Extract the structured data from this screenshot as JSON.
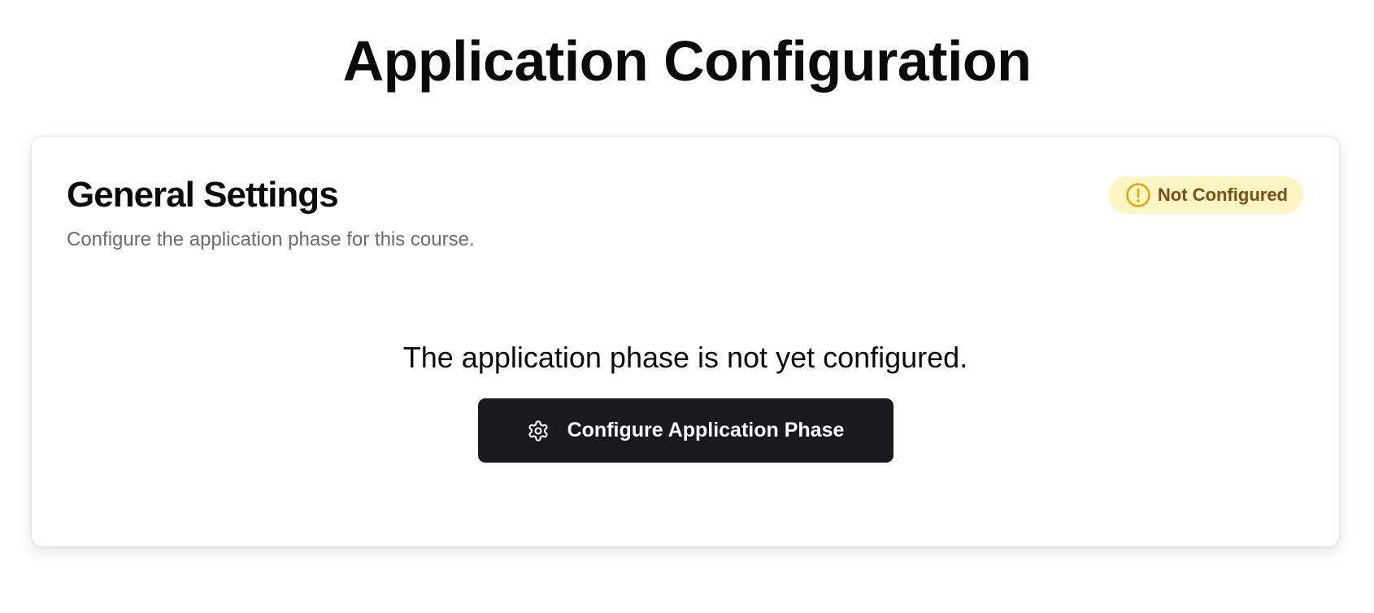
{
  "page": {
    "title": "Application Configuration"
  },
  "settings_card": {
    "title": "General Settings",
    "subtitle": "Configure the application phase for this course.",
    "status_badge": {
      "label": "Not Configured",
      "icon": "alert-circle-icon",
      "background": "#fdf6c4",
      "text_color": "#7a4d12",
      "icon_color": "#e0a400"
    },
    "empty_state": {
      "message": "The application phase is not yet configured.",
      "button_label": "Configure Application Phase",
      "button_icon": "gear-icon",
      "button_color": "#1a1a1c"
    }
  }
}
